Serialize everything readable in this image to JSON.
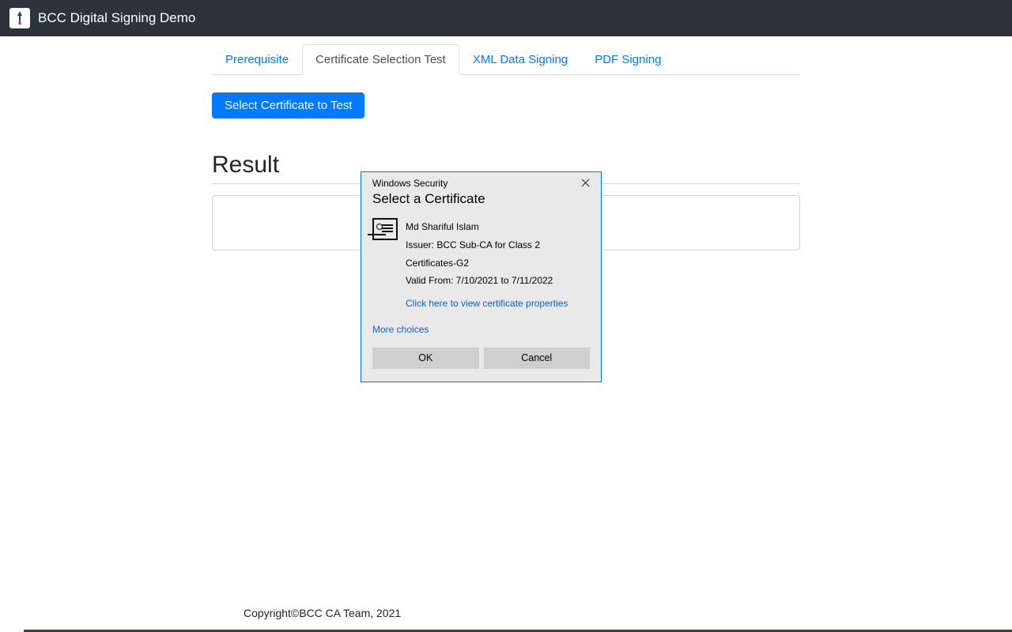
{
  "header": {
    "title": "BCC Digital Signing Demo"
  },
  "tabs": {
    "items": [
      {
        "label": "Prerequisite"
      },
      {
        "label": "Certificate Selection Test"
      },
      {
        "label": "XML Data Signing"
      },
      {
        "label": "PDF Signing"
      }
    ],
    "active_index": 1
  },
  "main": {
    "select_button_label": "Select Certificate to Test",
    "result_heading": "Result"
  },
  "dialog": {
    "window_title": "Windows Security",
    "heading": "Select a Certificate",
    "certificate": {
      "subject": "Md Shariful Islam",
      "issuer_line": "Issuer: BCC Sub-CA for Class 2 Certificates-G2",
      "validity_line": "Valid From: 7/10/2021 to 7/11/2022",
      "properties_link": "Click here to view certificate properties"
    },
    "more_choices_label": "More choices",
    "ok_label": "OK",
    "cancel_label": "Cancel"
  },
  "footer": {
    "text": "Copyright©BCC CA Team, 2021"
  }
}
